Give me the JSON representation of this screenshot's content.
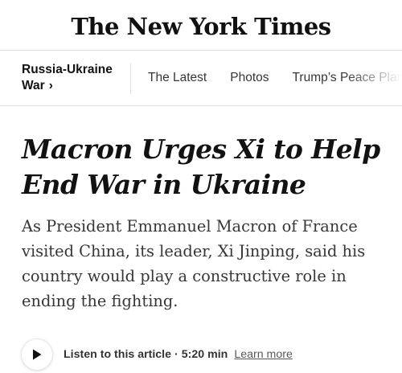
{
  "masthead": {
    "logo_text": "The New York Times"
  },
  "nav": {
    "section_label": "Russia-Ukraine War",
    "section_chevron": "›",
    "items": [
      {
        "label": "The Latest"
      },
      {
        "label": "Photos"
      },
      {
        "label": "Trump’s Peace Plan"
      }
    ]
  },
  "article": {
    "headline": "Macron Urges Xi to Help End War in Ukraine",
    "summary": "As President Emmanuel Macron of France visited China, its leader, Xi Jinping, said his country would play a constructive role in ending the fighting."
  },
  "audio": {
    "play_icon": "play-icon",
    "listen_label": "Listen to this article",
    "separator": "·",
    "duration": "5:20 min",
    "learn_more_label": "Learn more"
  }
}
